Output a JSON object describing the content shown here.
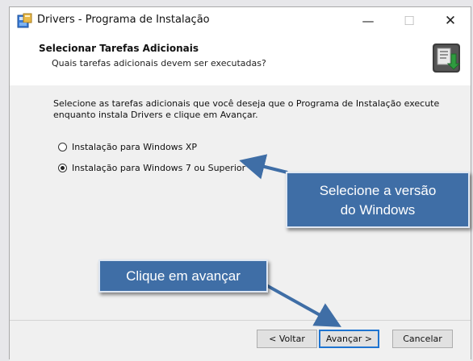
{
  "window": {
    "title": "Drivers - Programa de Instalação",
    "min_glyph": "—",
    "max_glyph": "☐",
    "close_glyph": "✕"
  },
  "header": {
    "title": "Selecionar Tarefas Adicionais",
    "subtitle": "Quais tarefas adicionais devem ser executadas?"
  },
  "content": {
    "description": "Selecione as tarefas adicionais que você deseja que o Programa de Instalação execute enquanto instala Drivers e clique em Avançar.",
    "options": [
      {
        "label": "Instalação para Windows XP",
        "selected": false
      },
      {
        "label": "Instalação para Windows 7 ou Superior",
        "selected": true
      }
    ]
  },
  "footer": {
    "back_label": "< Voltar",
    "next_label": "Avançar >",
    "cancel_label": "Cancelar"
  },
  "annotations": {
    "version_callout_line1": "Selecione a versão",
    "version_callout_line2": "do Windows",
    "next_callout": "Clique em avançar",
    "color": "#3f6ea6"
  }
}
